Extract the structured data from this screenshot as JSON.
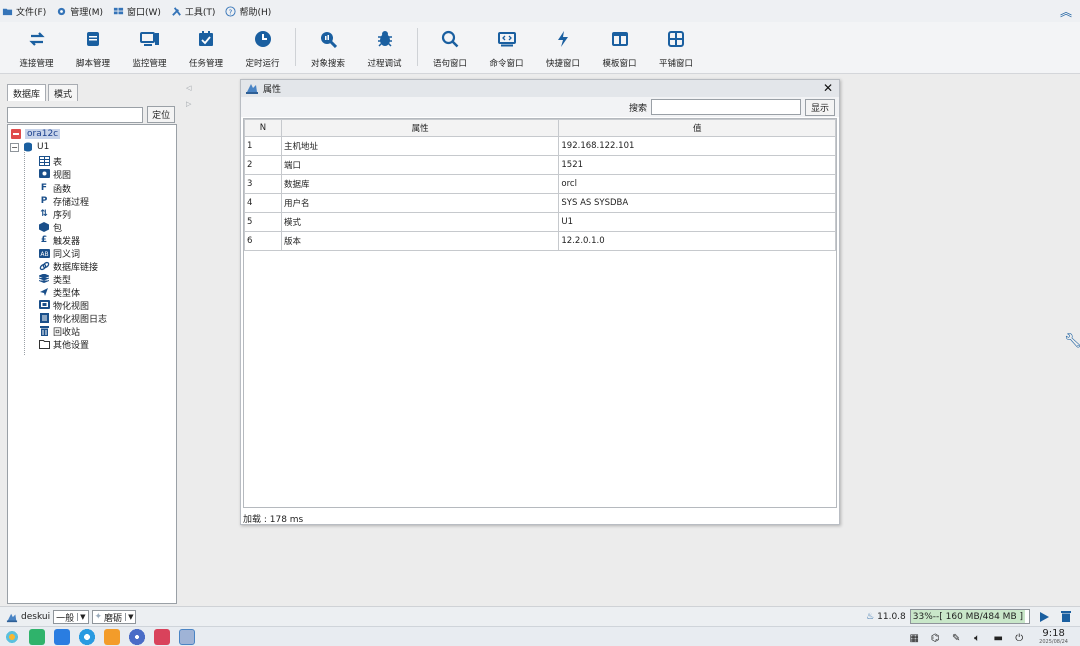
{
  "menubar": {
    "items": [
      {
        "label": "文件(F)",
        "icon": "folder-icon",
        "color": "#2f6fb6"
      },
      {
        "label": "管理(M)",
        "icon": "gear-icon",
        "color": "#2f6fb6"
      },
      {
        "label": "窗口(W)",
        "icon": "window-icon",
        "color": "#2f6fb6"
      },
      {
        "label": "工具(T)",
        "icon": "tools-icon",
        "color": "#2f6fb6"
      },
      {
        "label": "帮助(H)",
        "icon": "help-icon",
        "color": "#2f6fb6"
      }
    ]
  },
  "toolbar": {
    "buttons": [
      {
        "label": "连接管理",
        "icon": "connect-icon"
      },
      {
        "label": "脚本管理",
        "icon": "script-icon"
      },
      {
        "label": "监控管理",
        "icon": "monitor-icon"
      },
      {
        "label": "任务管理",
        "icon": "task-icon"
      },
      {
        "label": "定时运行",
        "icon": "clock-icon"
      },
      {
        "label": "对象搜索",
        "icon": "object-search-icon"
      },
      {
        "label": "过程调试",
        "icon": "debug-icon"
      },
      {
        "label": "语句窗口",
        "icon": "search-icon"
      },
      {
        "label": "命令窗口",
        "icon": "command-icon"
      },
      {
        "label": "快捷窗口",
        "icon": "lightning-icon"
      },
      {
        "label": "模板窗口",
        "icon": "template-icon"
      },
      {
        "label": "平铺窗口",
        "icon": "tile-icon"
      }
    ]
  },
  "leftpanel": {
    "tabs": [
      "数据库",
      "模式"
    ],
    "locate_label": "定位",
    "tree": {
      "connection": "ora12c",
      "schema": "U1",
      "items": [
        "表",
        "视图",
        "函数",
        "存储过程",
        "序列",
        "包",
        "触发器",
        "同义词",
        "数据库链接",
        "类型",
        "类型体",
        "物化视图",
        "物化视图日志",
        "回收站",
        "其他设置"
      ]
    }
  },
  "dialog": {
    "title": "属性",
    "search_label": "搜索",
    "show_label": "显示",
    "columns": [
      "N",
      "属性",
      "值"
    ],
    "rows": [
      {
        "n": "1",
        "attr": "主机地址",
        "value": "192.168.122.101"
      },
      {
        "n": "2",
        "attr": "端口",
        "value": "1521"
      },
      {
        "n": "3",
        "attr": "数据库",
        "value": "orcl"
      },
      {
        "n": "4",
        "attr": "用户名",
        "value": "SYS AS SYSDBA"
      },
      {
        "n": "5",
        "attr": "模式",
        "value": "U1"
      },
      {
        "n": "6",
        "attr": "版本",
        "value": "12.2.0.1.0"
      }
    ],
    "status": "加载 : 178 ms"
  },
  "statusbar": {
    "user": "deskui",
    "mode": "一般",
    "theme": "磨砺",
    "version": "11.0.8",
    "memory": "33%--[ 160 MB/484 MB ]",
    "memory_fraction": 0.33
  },
  "taskbar": {
    "time": "9:18",
    "date": "2025/08/24"
  },
  "colors": {
    "accent": "#1a5fa0",
    "selection": "#c7d3ea"
  }
}
